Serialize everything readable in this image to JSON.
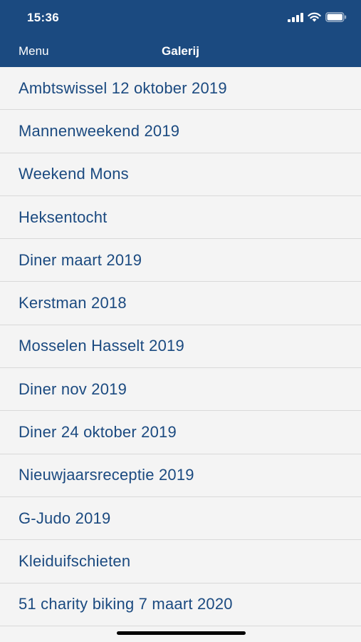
{
  "status_bar": {
    "time": "15:36",
    "icons": [
      "signal-icon",
      "wifi-icon",
      "battery-icon"
    ]
  },
  "navbar": {
    "menu_label": "Menu",
    "title": "Galerij"
  },
  "colors": {
    "brand": "#1b4a80",
    "background": "#f4f4f4",
    "divider": "#d9d9d9"
  },
  "gallery": {
    "items": [
      {
        "label": "Ambtswissel 12 oktober 2019"
      },
      {
        "label": "Mannenweekend 2019"
      },
      {
        "label": "Weekend Mons"
      },
      {
        "label": "Heksentocht"
      },
      {
        "label": "Diner maart 2019"
      },
      {
        "label": "Kerstman 2018"
      },
      {
        "label": "Mosselen Hasselt 2019"
      },
      {
        "label": "Diner nov 2019"
      },
      {
        "label": "Diner 24 oktober 2019"
      },
      {
        "label": "Nieuwjaarsreceptie 2019"
      },
      {
        "label": "G-Judo 2019"
      },
      {
        "label": "Kleiduifschieten"
      },
      {
        "label": "51 charity biking 7 maart 2020"
      }
    ]
  }
}
